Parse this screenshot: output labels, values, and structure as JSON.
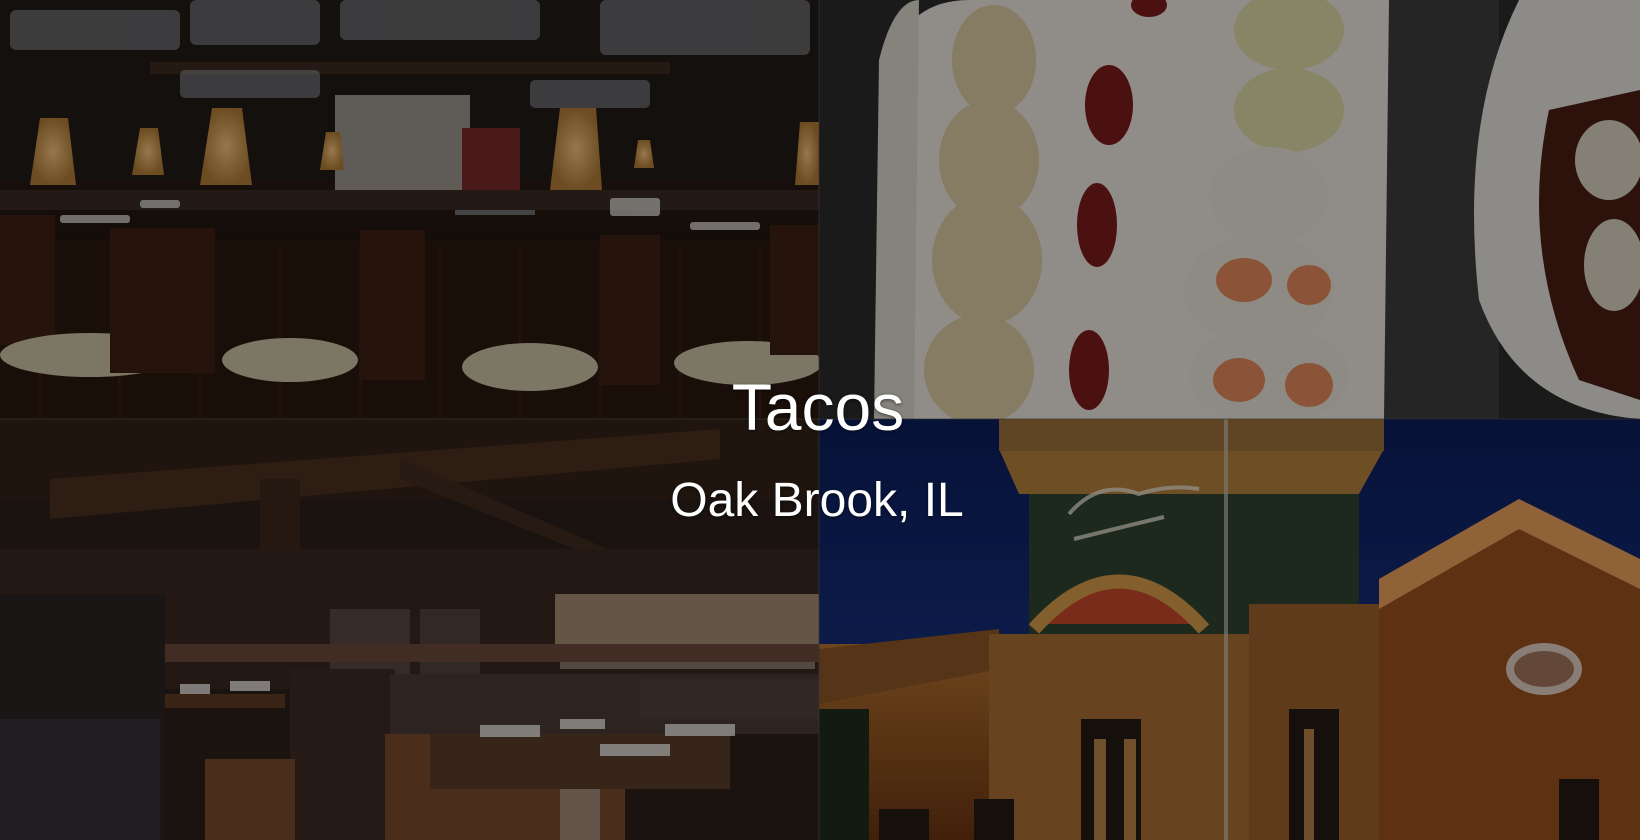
{
  "hero": {
    "title": "Tacos",
    "location": "Oak Brook, IL"
  },
  "tiles": [
    {
      "subject": "bar-interior-photo"
    },
    {
      "subject": "sushi-rolls-photo"
    },
    {
      "subject": "dining-booths-photo"
    },
    {
      "subject": "restaurant-exterior-night-photo"
    }
  ]
}
